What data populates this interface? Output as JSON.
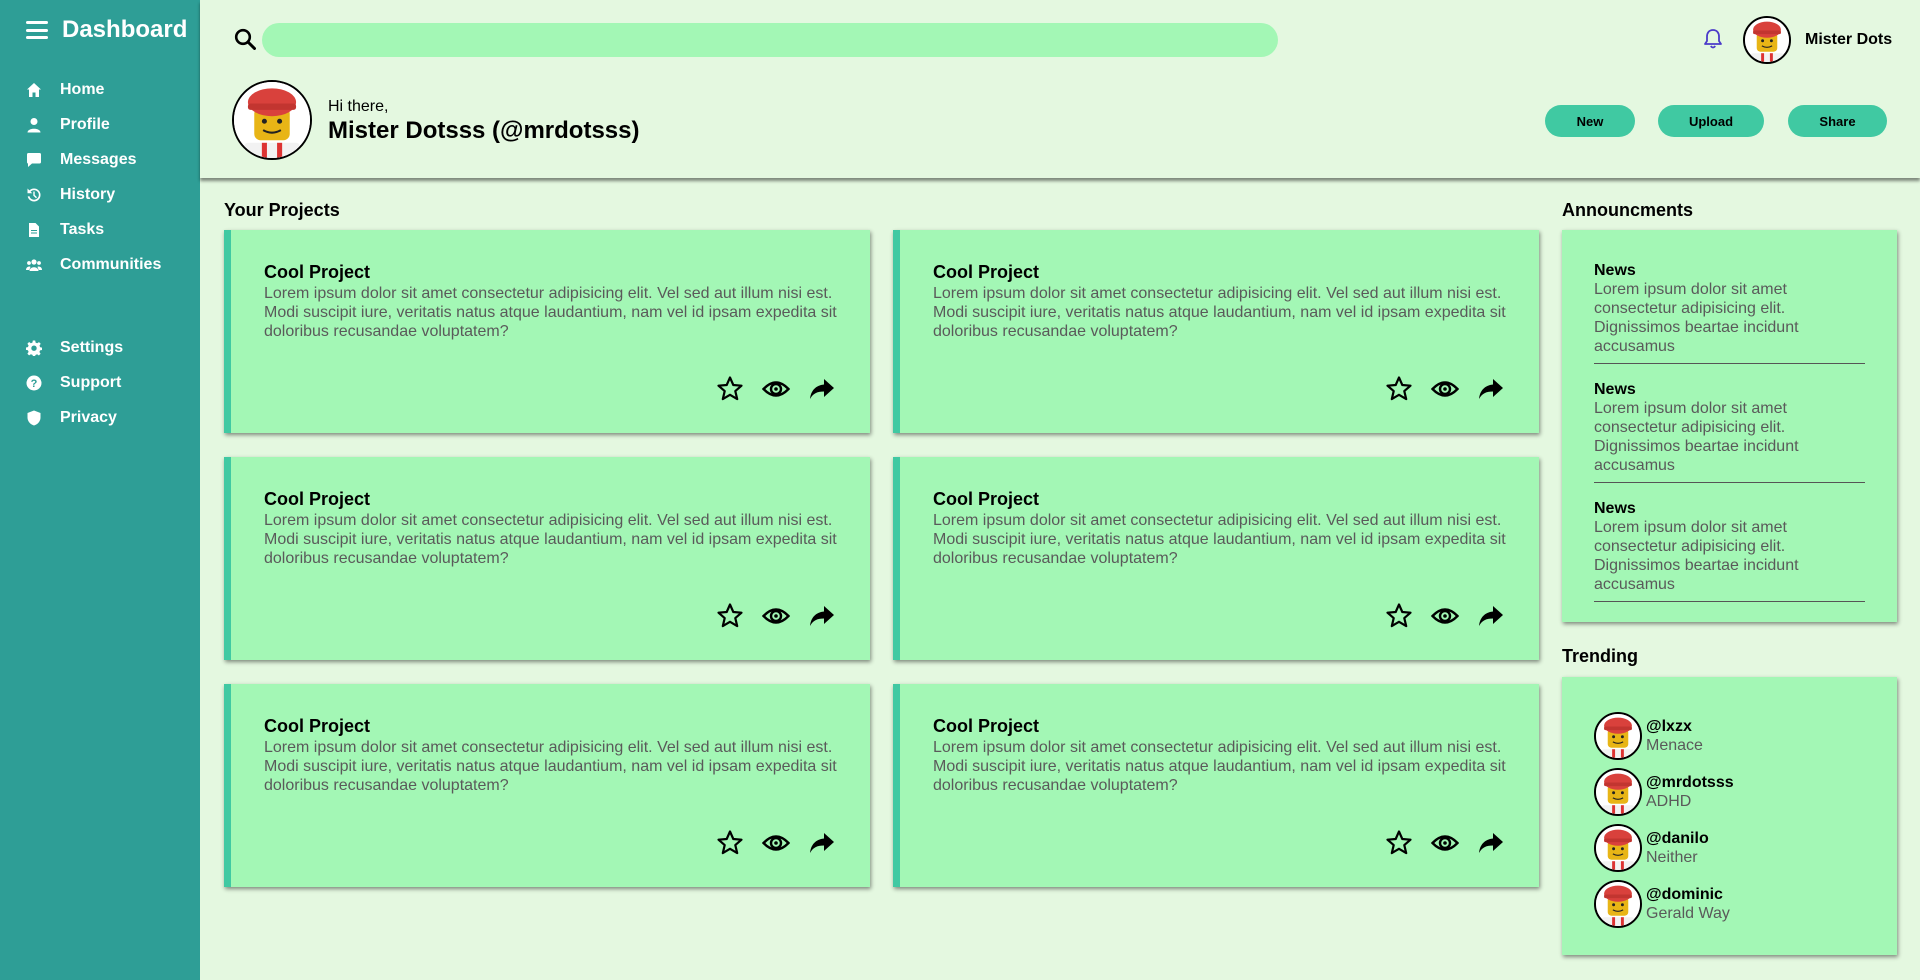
{
  "sidebar": {
    "title": "Dashboard",
    "items": [
      {
        "label": "Home",
        "icon": "home-icon"
      },
      {
        "label": "Profile",
        "icon": "user-icon"
      },
      {
        "label": "Messages",
        "icon": "chat-icon"
      },
      {
        "label": "History",
        "icon": "history-icon"
      },
      {
        "label": "Tasks",
        "icon": "file-icon"
      },
      {
        "label": "Communities",
        "icon": "users-icon"
      }
    ],
    "bottom_items": [
      {
        "label": "Settings",
        "icon": "gear-icon"
      },
      {
        "label": "Support",
        "icon": "help-icon"
      },
      {
        "label": "Privacy",
        "icon": "shield-icon"
      }
    ]
  },
  "header": {
    "search_placeholder": "",
    "user_name": "Mister Dots",
    "greeting": "Hi there,",
    "full_name": "Mister Dotsss (@mrdotsss)",
    "buttons": {
      "new": "New",
      "upload": "Upload",
      "share": "Share"
    }
  },
  "projects": {
    "heading": "Your Projects",
    "items": [
      {
        "title": "Cool Project",
        "description": "Lorem ipsum dolor sit amet consectetur adipisicing elit. Vel sed aut illum nisi est. Modi suscipit iure, veritatis natus atque laudantium, nam vel id ipsam expedita sit doloribus recusandae voluptatem?"
      },
      {
        "title": "Cool Project",
        "description": "Lorem ipsum dolor sit amet consectetur adipisicing elit. Vel sed aut illum nisi est. Modi suscipit iure, veritatis natus atque laudantium, nam vel id ipsam expedita sit doloribus recusandae voluptatem?"
      },
      {
        "title": "Cool Project",
        "description": "Lorem ipsum dolor sit amet consectetur adipisicing elit. Vel sed aut illum nisi est. Modi suscipit iure, veritatis natus atque laudantium, nam vel id ipsam expedita sit doloribus recusandae voluptatem?"
      },
      {
        "title": "Cool Project",
        "description": "Lorem ipsum dolor sit amet consectetur adipisicing elit. Vel sed aut illum nisi est. Modi suscipit iure, veritatis natus atque laudantium, nam vel id ipsam expedita sit doloribus recusandae voluptatem?"
      },
      {
        "title": "Cool Project",
        "description": "Lorem ipsum dolor sit amet consectetur adipisicing elit. Vel sed aut illum nisi est. Modi suscipit iure, veritatis natus atque laudantium, nam vel id ipsam expedita sit doloribus recusandae voluptatem?"
      },
      {
        "title": "Cool Project",
        "description": "Lorem ipsum dolor sit amet consectetur adipisicing elit. Vel sed aut illum nisi est. Modi suscipit iure, veritatis natus atque laudantium, nam vel id ipsam expedita sit doloribus recusandae voluptatem?"
      }
    ],
    "action_icons": [
      "star-icon",
      "eye-icon",
      "share-icon"
    ]
  },
  "announcements": {
    "heading": "Announcments",
    "items": [
      {
        "title": "News",
        "text": "Lorem ipsum dolor sit amet consectetur adipisicing elit. Dignissimos beartae incidunt accusamus"
      },
      {
        "title": "News",
        "text": "Lorem ipsum dolor sit amet consectetur adipisicing elit. Dignissimos beartae incidunt accusamus"
      },
      {
        "title": "News",
        "text": "Lorem ipsum dolor sit amet consectetur adipisicing elit. Dignissimos beartae incidunt accusamus"
      }
    ]
  },
  "trending": {
    "heading": "Trending",
    "items": [
      {
        "handle": "@lxzx",
        "desc": "Menace"
      },
      {
        "handle": "@mrdotsss",
        "desc": "ADHD"
      },
      {
        "handle": "@danilo",
        "desc": "Neither"
      },
      {
        "handle": "@dominic",
        "desc": "Gerald Way"
      }
    ]
  },
  "colors": {
    "sidebar": "#2e9e96",
    "background": "#e4f8e0",
    "card": "#a3f7b5",
    "accent": "#40c9a2"
  }
}
